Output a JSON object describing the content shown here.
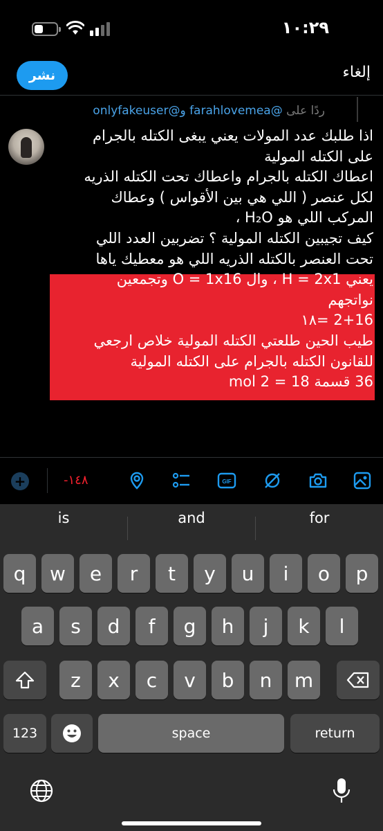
{
  "status": {
    "time": "١٠:٢٩"
  },
  "header": {
    "cancel_label": "إلغاء",
    "publish_label": "نشر"
  },
  "reply": {
    "prefix": "ردًا على",
    "mentions": "@farahlovemea و@onlyfakeuser"
  },
  "tweet": {
    "lines": [
      "اذا طلبك عدد المولات يعني يبغى الكتله بالجرام",
      "على الكتله المولية",
      "اعطاك الكتله بالجرام واعطاك تحت الكتله الذريه",
      "لكل عنصر ( اللي هي بين الأقواس ) وعطاك",
      "المركب اللي هو  H₂O ،",
      "كيف تجيبين الكتله المولية ؟ تضربين العدد اللي",
      "تحت العنصر بالكتله الذريه اللي هو معطيك ياها"
    ],
    "highlight_lines": [
      "يعني H = 2x1 ، وال O = 1x16  وتجمعين",
      "نواتجهم",
      "2+16 =١٨",
      "طيب الحين طلعتي الكتله المولية خلاص ارجعي",
      "للقانون الكتله بالجرام على الكتله المولية",
      "36 قسمة 18 = 2 mol"
    ]
  },
  "toolbar": {
    "char_count": "-١٤٨",
    "icons": [
      "add-icon",
      "location-icon",
      "poll-icon",
      "gif-icon",
      "sensitive-icon",
      "camera-icon",
      "image-icon"
    ],
    "accent": "#1d9bf0",
    "count_color": "#f4212e"
  },
  "keyboard": {
    "suggestions": [
      "is",
      "and",
      "for"
    ],
    "row1": [
      "q",
      "w",
      "e",
      "r",
      "t",
      "y",
      "u",
      "i",
      "o",
      "p"
    ],
    "row2": [
      "a",
      "s",
      "d",
      "f",
      "g",
      "h",
      "j",
      "k",
      "l"
    ],
    "row3": [
      "z",
      "x",
      "c",
      "v",
      "b",
      "n",
      "m"
    ],
    "numbers_label": "123",
    "space_label": "space",
    "return_label": "return"
  },
  "highlight_color": "#e8232f"
}
